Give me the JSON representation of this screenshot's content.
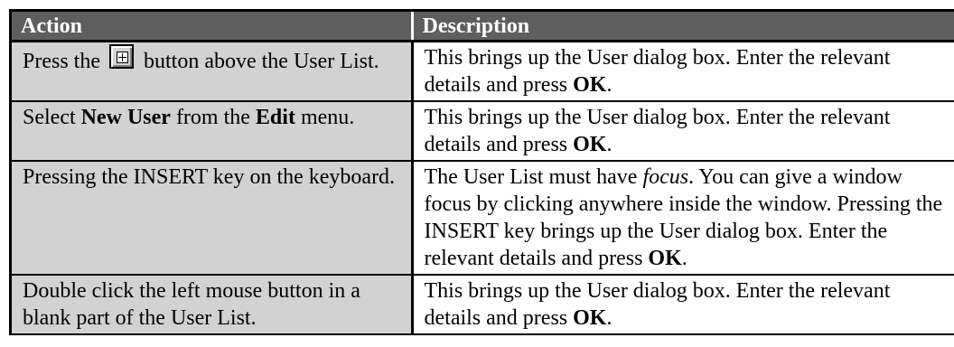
{
  "table": {
    "headers": [
      "Action",
      "Description"
    ],
    "rows": [
      {
        "action_before": "Press the ",
        "action_icon": "add-user-icon",
        "action_after": " button above the User List.",
        "desc_before": "This brings up the User dialog box. Enter the relevant details and press ",
        "desc_bold": "OK",
        "desc_after": "."
      },
      {
        "action_before": "Select ",
        "action_bold1": "New User",
        "action_mid": " from the ",
        "action_bold2": "Edit",
        "action_after": " menu.",
        "desc_before": "This brings up the User dialog box. Enter the relevant details and press ",
        "desc_bold": "OK",
        "desc_after": "."
      },
      {
        "action_text": "Pressing the INSERT key on the keyboard.",
        "desc_before": "The User List must have ",
        "desc_italic": "focus",
        "desc_mid": ". You can give a window focus by clicking anywhere inside the window. Pressing the INSERT key brings up the User dialog box. Enter the relevant details and press ",
        "desc_bold": "OK",
        "desc_after": "."
      },
      {
        "action_text": "Double click the left mouse button in a blank part of the User List.",
        "desc_before": "This brings up the User dialog box. Enter the relevant details and press ",
        "desc_bold": "OK",
        "desc_after": "."
      }
    ]
  }
}
